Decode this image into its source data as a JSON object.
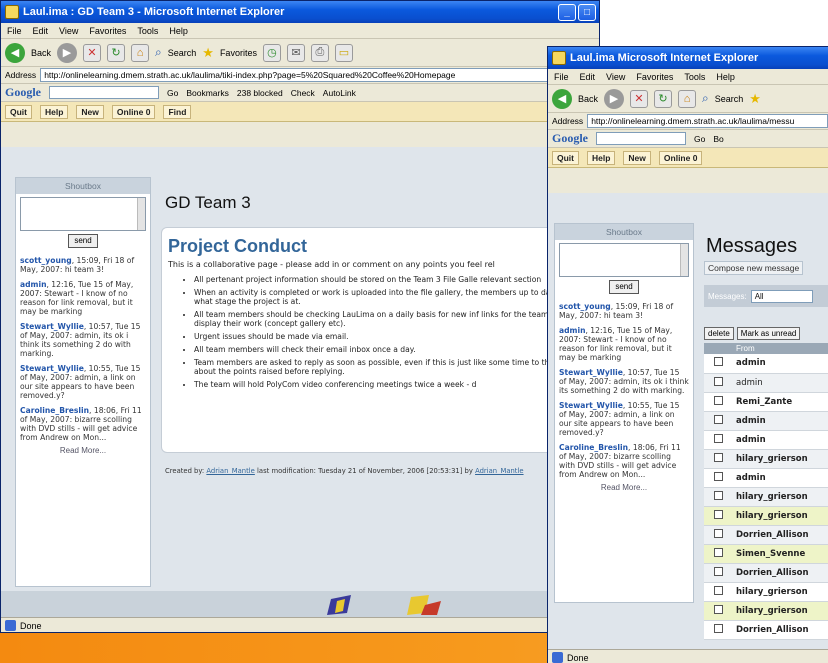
{
  "left_window": {
    "title": "Laul.ima : GD Team 3 - Microsoft Internet Explorer",
    "menu": [
      "File",
      "Edit",
      "View",
      "Favorites",
      "Tools",
      "Help"
    ],
    "toolbar": {
      "back": "Back",
      "search": "Search",
      "favorites": "Favorites"
    },
    "address_label": "Address",
    "address_value": "http://onlinelearning.dmem.strath.ac.uk/laulima/tiki-index.php?page=5%20Squared%20Coffee%20Homepage",
    "google": {
      "logo": "Google",
      "go": "Go",
      "bookmarks": "Bookmarks",
      "blocked": "238 blocked",
      "check": "Check",
      "autolink": "AutoLink"
    },
    "sitebar": {
      "quit": "Quit",
      "help": "Help",
      "new": "New",
      "online": "Online 0",
      "find": "Find"
    },
    "page_title": "GD Team 3",
    "conduct": {
      "title": "Project Conduct",
      "intro": "This is a collaborative page - please add in or comment on any points you feel rel",
      "items": [
        "All pertenant project information should be stored on the Team 3 File Galle relevant section",
        "When an activity is completed or work is uploaded into the file gallery, the members up to date with what stage the project is at.",
        "All team members should be checking LauLima on a daily basis for new inf links for the team to display their work (concept gallery etc).",
        "Urgent issues should be made via email.",
        "All team members will check their email inbox once a day.",
        "Team members are asked to reply as soon as possible, even if this is just like some time to think about the points raised before replying.",
        "The team will hold PolyCom video conferencing meetings twice a week - d"
      ]
    },
    "created": {
      "prefix": "Created by:",
      "author": "Adrian_Mantle",
      "mid": "last modification: Tuesday 21 of November, 2006 [20:53:31] by",
      "author2": "Adrian_Mantle"
    },
    "status": "Done"
  },
  "right_window": {
    "title": "Laul.ima  Microsoft Internet Explorer",
    "menu": [
      "File",
      "Edit",
      "View",
      "Favorites",
      "Tools",
      "Help"
    ],
    "toolbar": {
      "back": "Back",
      "search": "Search"
    },
    "address_label": "Address",
    "address_value": "http://onlinelearning.dmem.strath.ac.uk/laulima/messu",
    "google": {
      "logo": "Google",
      "go": "Go",
      "bookmarks": "Bo"
    },
    "sitebar": {
      "quit": "Quit",
      "help": "Help",
      "new": "New",
      "online": "Online 0"
    },
    "messages_title": "Messages",
    "compose": "Compose new message",
    "filter_label": "Messages:",
    "filter_value": "All",
    "actions": {
      "delete": "delete",
      "mark": "Mark as unread"
    },
    "table_header_from": "From",
    "rows": [
      {
        "from": "admin",
        "unread": true,
        "style": "even"
      },
      {
        "from": "admin",
        "unread": false,
        "style": "odd"
      },
      {
        "from": "Remi_Zante",
        "unread": true,
        "style": "even"
      },
      {
        "from": "admin",
        "unread": true,
        "style": "odd"
      },
      {
        "from": "admin",
        "unread": true,
        "style": "even"
      },
      {
        "from": "hilary_grierson",
        "unread": true,
        "style": "odd"
      },
      {
        "from": "admin",
        "unread": true,
        "style": "even"
      },
      {
        "from": "hilary_grierson",
        "unread": true,
        "style": "odd"
      },
      {
        "from": "hilary_grierson",
        "unread": true,
        "style": "hl"
      },
      {
        "from": "Dorrien_Allison",
        "unread": true,
        "style": "odd"
      },
      {
        "from": "Simen_Svenne",
        "unread": true,
        "style": "hl"
      },
      {
        "from": "Dorrien_Allison",
        "unread": true,
        "style": "odd"
      },
      {
        "from": "hilary_grierson",
        "unread": true,
        "style": "even"
      },
      {
        "from": "hilary_grierson",
        "unread": true,
        "style": "hl"
      },
      {
        "from": "Dorrien_Allison",
        "unread": true,
        "style": "even"
      }
    ],
    "status": "Done"
  },
  "shoutbox": {
    "title": "Shoutbox",
    "send": "send",
    "entries": [
      {
        "user": "scott_young",
        "text": ", 15:09, Fri 18 of May, 2007: hi team 3!"
      },
      {
        "user": "admin",
        "text": ", 12:16, Tue 15 of May, 2007: Stewart - I know of no reason for link removal, but it may be marking"
      },
      {
        "user": "Stewart_Wyllie",
        "text": ", 10:57, Tue 15 of May, 2007: admin, its ok i think its something 2 do with marking."
      },
      {
        "user": "Stewart_Wyllie",
        "text": ", 10:55, Tue 15 of May, 2007: admin, a link on our site appears to have been removed.y?"
      },
      {
        "user": "Caroline_Breslin",
        "text": ", 18:06, Fri 11 of May, 2007: bizarre scolling with DVD stills - will get advice from Andrew on Mon..."
      }
    ],
    "read_more": "Read More..."
  }
}
